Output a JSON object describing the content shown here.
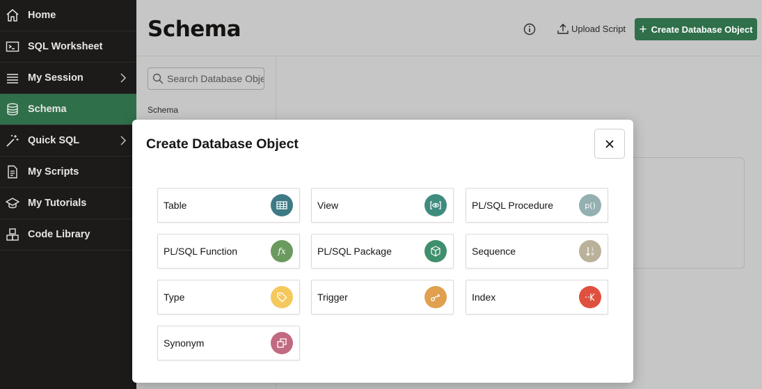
{
  "sidebar": {
    "items": [
      {
        "label": "Home",
        "icon": "home-icon"
      },
      {
        "label": "SQL Worksheet",
        "icon": "terminal-icon"
      },
      {
        "label": "My Session",
        "icon": "list-icon",
        "chevron": true
      },
      {
        "label": "Schema",
        "icon": "database-icon",
        "active": true
      },
      {
        "label": "Quick SQL",
        "icon": "magic-wand-icon",
        "chevron": true
      },
      {
        "label": "My Scripts",
        "icon": "document-icon"
      },
      {
        "label": "My Tutorials",
        "icon": "graduation-cap-icon"
      },
      {
        "label": "Code Library",
        "icon": "blocks-icon"
      }
    ]
  },
  "header": {
    "title": "Schema",
    "upload_label": "Upload Script",
    "create_label": "Create Database Object"
  },
  "left_panel": {
    "search_placeholder": "Search Database Objects",
    "schema_label": "Schema"
  },
  "modal": {
    "title": "Create Database Object",
    "tiles": [
      {
        "label": "Table",
        "icon": "table-icon",
        "color": "#3d7a85"
      },
      {
        "label": "View",
        "icon": "eye-icon",
        "color": "#3f8c7f"
      },
      {
        "label": "PL/SQL Procedure",
        "icon": "procedure-icon",
        "color": "#94b0b0"
      },
      {
        "label": "PL/SQL Function",
        "icon": "function-icon",
        "color": "#6b9a5f"
      },
      {
        "label": "PL/SQL Package",
        "icon": "package-icon",
        "color": "#3f8f6d"
      },
      {
        "label": "Sequence",
        "icon": "sequence-icon",
        "color": "#b9b19a"
      },
      {
        "label": "Type",
        "icon": "tag-icon",
        "color": "#f4c85c"
      },
      {
        "label": "Trigger",
        "icon": "trigger-icon",
        "color": "#e0a04f"
      },
      {
        "label": "Index",
        "icon": "index-icon",
        "color": "#e0503e"
      },
      {
        "label": "Synonym",
        "icon": "synonym-icon",
        "color": "#c26a80"
      }
    ]
  },
  "colors": {
    "accent": "#2f6f4a",
    "sidebar_bg": "#1c1b1a"
  }
}
